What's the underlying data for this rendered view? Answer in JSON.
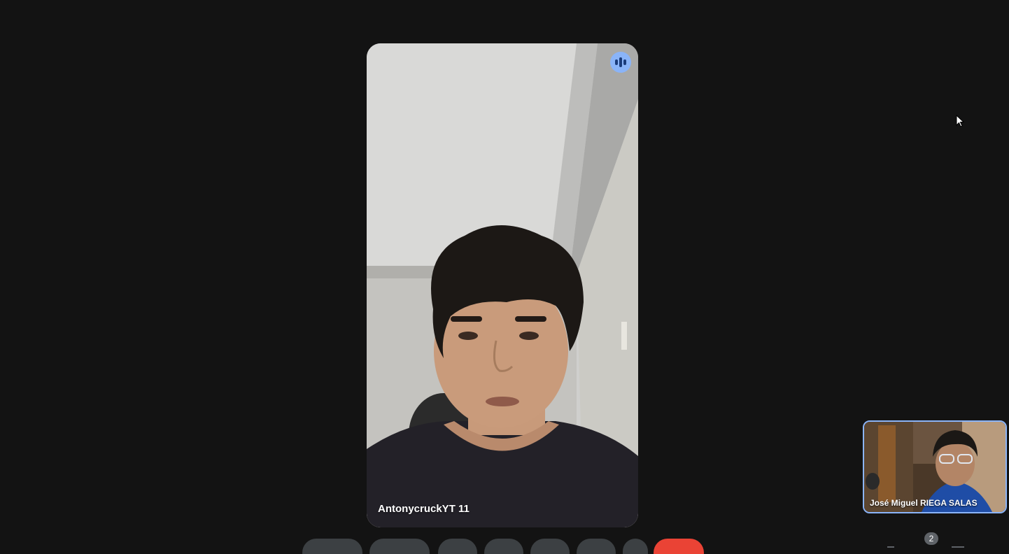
{
  "main_participant": {
    "name": "AntonycruckYT 11",
    "speaking_icon": "audio-level-icon"
  },
  "self_view": {
    "name": "José Miguel RIEGA SALAS"
  },
  "controls": {
    "participants_count": "2"
  },
  "colors": {
    "background": "#131313",
    "accent": "#8ab4f8",
    "control_button": "#3c4043",
    "hangup": "#ea4335"
  }
}
